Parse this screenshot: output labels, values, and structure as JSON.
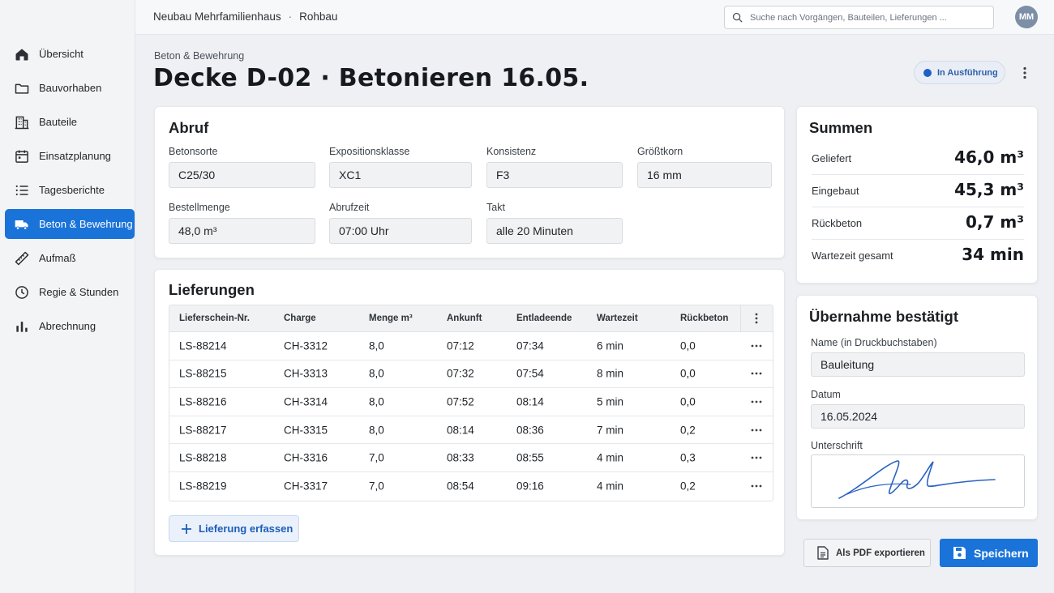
{
  "topbar": {
    "breadcrumb": [
      "Neubau Mehrfamilienhaus",
      "Rohbau"
    ],
    "breadcrumb_sep": "·",
    "search_placeholder": "Suche nach Vorgängen, Bauteilen, Lieferungen ...",
    "avatar_initials": "MM"
  },
  "sidebar": {
    "items": [
      {
        "label": "Übersicht",
        "icon": "home-icon"
      },
      {
        "label": "Bauvorhaben",
        "icon": "folder-icon"
      },
      {
        "label": "Bauteile",
        "icon": "building-icon"
      },
      {
        "label": "Einsatzplanung",
        "icon": "calendar-icon"
      },
      {
        "label": "Tagesberichte",
        "icon": "list-icon"
      },
      {
        "label": "Beton & Bewehrung",
        "icon": "truck-icon",
        "active": true
      },
      {
        "label": "Aufmaß",
        "icon": "ruler-icon"
      },
      {
        "label": "Regie & Stunden",
        "icon": "clock-icon"
      },
      {
        "label": "Abrechnung",
        "icon": "bar-chart-icon"
      }
    ]
  },
  "header": {
    "subtitle": "Beton & Bewehrung",
    "title": "Decke D-02 · Betonieren 16.05.",
    "status": "In Ausführung",
    "status_color": "#1f5fc6"
  },
  "abruf": {
    "title": "Abruf",
    "fields": {
      "betonsorte": {
        "label": "Betonsorte",
        "value": "C25/30"
      },
      "expositionsklasse": {
        "label": "Expositionsklasse",
        "value": "XC1"
      },
      "konsistenz": {
        "label": "Konsistenz",
        "value": "F3"
      },
      "groesstkorn": {
        "label": "Größtkorn",
        "value": "16 mm"
      },
      "bestellmenge": {
        "label": "Bestellmenge",
        "value": "48,0 m³"
      },
      "abrufzeit": {
        "label": "Abrufzeit",
        "value": "07:00 Uhr"
      },
      "takt": {
        "label": "Takt",
        "value": "alle 20 Minuten"
      }
    }
  },
  "lieferungen": {
    "title": "Lieferungen",
    "columns": [
      "Lieferschein-Nr.",
      "Charge",
      "Menge m³",
      "Ankunft",
      "Entladeende",
      "Wartezeit",
      "Rückbeton"
    ],
    "rows": [
      [
        "LS-88214",
        "CH-3312",
        "8,0",
        "07:12",
        "07:34",
        "6 min",
        "0,0"
      ],
      [
        "LS-88215",
        "CH-3313",
        "8,0",
        "07:32",
        "07:54",
        "8 min",
        "0,0"
      ],
      [
        "LS-88216",
        "CH-3314",
        "8,0",
        "07:52",
        "08:14",
        "5 min",
        "0,0"
      ],
      [
        "LS-88217",
        "CH-3315",
        "8,0",
        "08:14",
        "08:36",
        "7 min",
        "0,2"
      ],
      [
        "LS-88218",
        "CH-3316",
        "7,0",
        "08:33",
        "08:55",
        "4 min",
        "0,3"
      ],
      [
        "LS-88219",
        "CH-3317",
        "7,0",
        "08:54",
        "09:16",
        "4 min",
        "0,2"
      ]
    ],
    "add_label": "Lieferung erfassen"
  },
  "summen": {
    "title": "Summen",
    "rows": [
      {
        "label": "Geliefert",
        "value": "46,0 m³"
      },
      {
        "label": "Eingebaut",
        "value": "45,3 m³"
      },
      {
        "label": "Rückbeton",
        "value": "0,7 m³"
      },
      {
        "label": "Wartezeit gesamt",
        "value": "34 min"
      }
    ]
  },
  "uebernahme": {
    "title": "Übernahme bestätigt",
    "name_label": "Name (in Druckbuchstaben)",
    "name_value": "Bauleitung",
    "datum_label": "Datum",
    "datum_value": "16.05.2024",
    "signature_label": "Unterschrift"
  },
  "actions": {
    "pdf_label": "Als PDF exportieren",
    "save_label": "Speichern"
  }
}
